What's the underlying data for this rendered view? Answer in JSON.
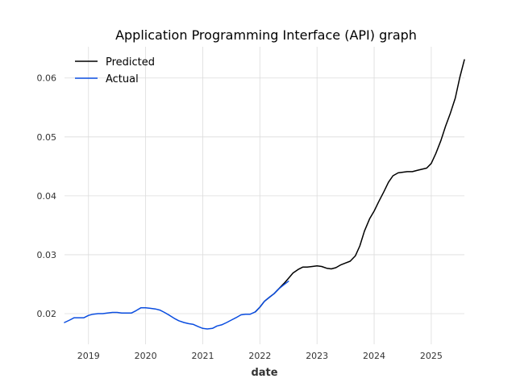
{
  "chart_data": {
    "type": "line",
    "title": "Application Programming Interface (API) graph",
    "xlabel": "date",
    "ylabel": "",
    "xlim": [
      2018.58,
      2025.58
    ],
    "ylim": [
      0.0148,
      0.0653
    ],
    "xticks": [
      2019,
      2020,
      2021,
      2022,
      2023,
      2024,
      2025
    ],
    "xtick_labels": [
      "2019",
      "2020",
      "2021",
      "2022",
      "2023",
      "2024",
      "2025"
    ],
    "yticks": [
      0.02,
      0.03,
      0.04,
      0.05,
      0.06
    ],
    "ytick_labels": [
      "0.02",
      "0.03",
      "0.04",
      "0.05",
      "0.06"
    ],
    "grid": true,
    "legend": "top-left",
    "series": [
      {
        "name": "Predicted",
        "color": "#000000",
        "x": [
          2021.92,
          2022.0,
          2022.08,
          2022.17,
          2022.25,
          2022.33,
          2022.42,
          2022.5,
          2022.58,
          2022.67,
          2022.75,
          2022.83,
          2022.92,
          2023.0,
          2023.08,
          2023.17,
          2023.25,
          2023.33,
          2023.42,
          2023.5,
          2023.58,
          2023.67,
          2023.75,
          2023.83,
          2023.92,
          2024.0,
          2024.08,
          2024.17,
          2024.25,
          2024.33,
          2024.42,
          2024.5,
          2024.58,
          2024.67,
          2024.75,
          2024.83,
          2024.92,
          2025.0,
          2025.08,
          2025.17,
          2025.25,
          2025.33,
          2025.42,
          2025.5,
          2025.58
        ],
        "y": [
          0.0203,
          0.0211,
          0.0221,
          0.0228,
          0.0234,
          0.0242,
          0.0251,
          0.026,
          0.0269,
          0.0275,
          0.0279,
          0.0279,
          0.028,
          0.0281,
          0.028,
          0.0277,
          0.0276,
          0.0278,
          0.0283,
          0.0286,
          0.0289,
          0.0298,
          0.0315,
          0.034,
          0.0361,
          0.0374,
          0.039,
          0.0407,
          0.0423,
          0.0434,
          0.0439,
          0.044,
          0.0441,
          0.0441,
          0.0443,
          0.0445,
          0.0447,
          0.0455,
          0.0472,
          0.0494,
          0.0518,
          0.0539,
          0.0566,
          0.0601,
          0.0631
        ]
      },
      {
        "name": "Actual",
        "color": "#0a4de0",
        "x": [
          2018.58,
          2018.67,
          2018.75,
          2018.83,
          2018.92,
          2019.0,
          2019.08,
          2019.17,
          2019.25,
          2019.33,
          2019.42,
          2019.5,
          2019.58,
          2019.67,
          2019.75,
          2019.83,
          2019.92,
          2020.0,
          2020.08,
          2020.17,
          2020.25,
          2020.33,
          2020.42,
          2020.5,
          2020.58,
          2020.67,
          2020.75,
          2020.83,
          2020.92,
          2021.0,
          2021.08,
          2021.17,
          2021.25,
          2021.33,
          2021.42,
          2021.5,
          2021.58,
          2021.67,
          2021.75,
          2021.83,
          2021.92,
          2022.0,
          2022.08,
          2022.17,
          2022.25,
          2022.33,
          2022.42,
          2022.5
        ],
        "y": [
          0.0185,
          0.0189,
          0.0193,
          0.0193,
          0.0193,
          0.0197,
          0.0199,
          0.02,
          0.02,
          0.0201,
          0.0202,
          0.0202,
          0.0201,
          0.0201,
          0.0201,
          0.0205,
          0.021,
          0.021,
          0.0209,
          0.0208,
          0.0206,
          0.0202,
          0.0197,
          0.0192,
          0.0188,
          0.0185,
          0.0183,
          0.0182,
          0.0178,
          0.0175,
          0.0174,
          0.0175,
          0.0179,
          0.0181,
          0.0185,
          0.0189,
          0.0193,
          0.0198,
          0.0199,
          0.0199,
          0.0203,
          0.0211,
          0.0221,
          0.0228,
          0.0234,
          0.0242,
          0.0249,
          0.0255
        ]
      }
    ]
  }
}
